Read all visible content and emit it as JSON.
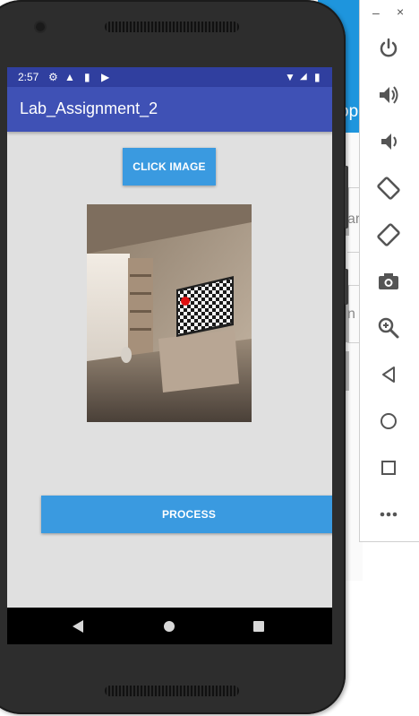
{
  "status_bar": {
    "time": "2:57",
    "icons": [
      "settings-icon",
      "drive-icon",
      "sd-card-icon",
      "play-store-icon"
    ],
    "right_icons": [
      "wifi-icon",
      "signal-icon",
      "battery-icon"
    ]
  },
  "app_bar": {
    "title": "Lab_Assignment_2"
  },
  "buttons": {
    "click_image": "CLICK IMAGE",
    "process": "PROCESS"
  },
  "image_view": {
    "content": "room-with-tv-checkerboard",
    "marker_color": "#e01010"
  },
  "nav_bar": {
    "icons": [
      "back-icon",
      "home-icon",
      "recent-apps-icon"
    ]
  },
  "emulator_toolbar": {
    "minimize": "–",
    "close": "×",
    "tools": [
      "power-icon",
      "volume-up-icon",
      "volume-down-icon",
      "rotate-left-icon",
      "rotate-right-icon",
      "camera-icon",
      "zoom-icon",
      "back-icon",
      "home-icon",
      "overview-icon",
      "more-icon"
    ]
  },
  "background_app": {
    "visible_fragment": "op",
    "field_chars": [
      "ar",
      "n"
    ]
  },
  "colors": {
    "status_bar": "#303f9f",
    "app_bar": "#3f51b5",
    "button": "#3a9ae0",
    "screen_bg": "#e0e0e0",
    "host_accent": "#1e95dd"
  }
}
